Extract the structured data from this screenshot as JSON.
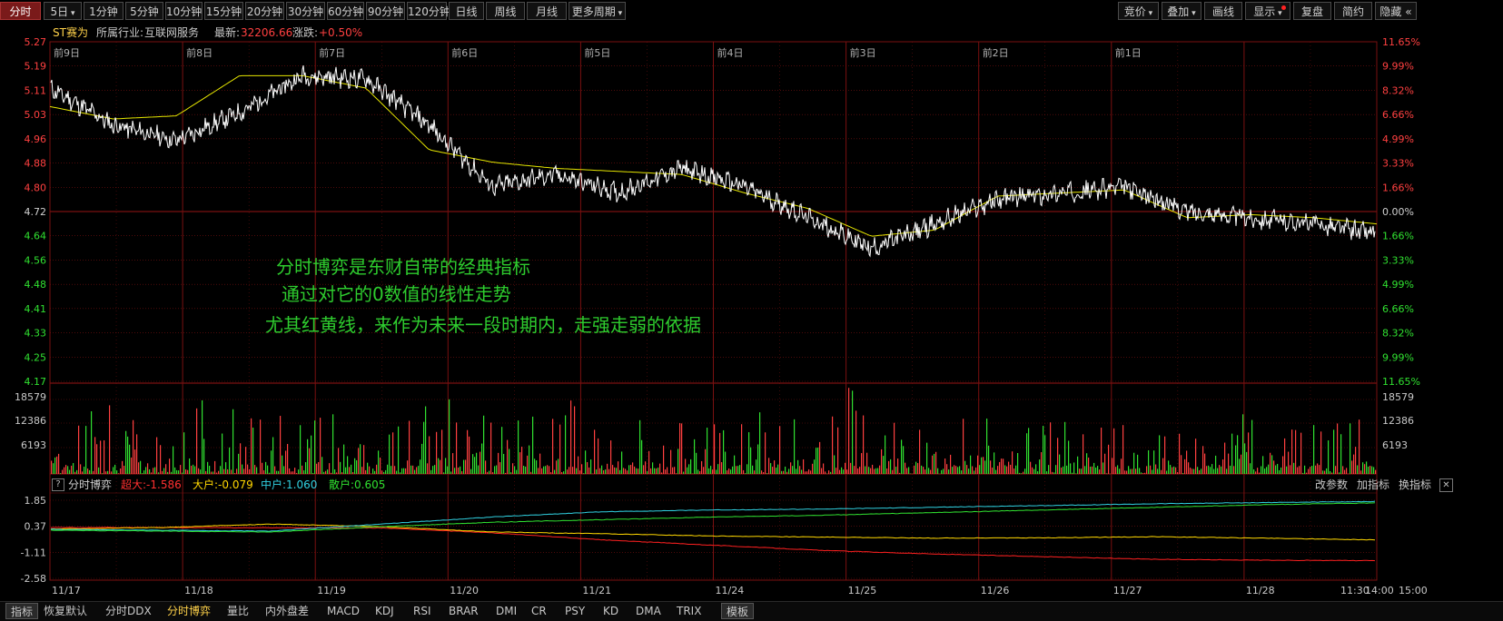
{
  "toolbar": {
    "left": [
      {
        "label": "分时",
        "active": true
      },
      {
        "label": "5日",
        "dropdown": true
      },
      {
        "label": "1分钟"
      },
      {
        "label": "5分钟"
      },
      {
        "label": "10分钟"
      },
      {
        "label": "15分钟"
      },
      {
        "label": "20分钟"
      },
      {
        "label": "30分钟"
      },
      {
        "label": "60分钟"
      },
      {
        "label": "90分钟"
      },
      {
        "label": "120分钟"
      },
      {
        "label": "日线"
      },
      {
        "label": "周线"
      },
      {
        "label": "月线"
      },
      {
        "label": "更多周期",
        "dropdown": true
      }
    ],
    "right": [
      {
        "label": "竞价",
        "dropdown": true
      },
      {
        "label": "叠加",
        "dropdown": true
      },
      {
        "label": "画线"
      },
      {
        "label": "显示",
        "dropdown": true,
        "dot": true
      },
      {
        "label": "复盘"
      },
      {
        "label": "简约"
      },
      {
        "label": "隐藏",
        "arrow": "«"
      }
    ]
  },
  "info": {
    "stock_name": "ST赛为",
    "industry_label": "所属行业:",
    "industry": "互联网服务",
    "latest_label": "最新:",
    "latest": "32206.66",
    "change_label": "涨跌:",
    "change": "+0.50%"
  },
  "day_labels": [
    "前9日",
    "前8日",
    "前7日",
    "前6日",
    "前5日",
    "前4日",
    "前3日",
    "前2日",
    "前1日"
  ],
  "price_axis": {
    "left": [
      "5.27",
      "5.19",
      "5.11",
      "5.03",
      "4.96",
      "4.88",
      "4.80",
      "4.72",
      "4.64",
      "4.56",
      "4.48",
      "4.41",
      "4.33",
      "4.25",
      "4.17"
    ],
    "right": [
      "11.65%",
      "9.99%",
      "8.32%",
      "6.66%",
      "4.99%",
      "3.33%",
      "1.66%",
      "0.00%",
      "1.66%",
      "3.33%",
      "4.99%",
      "6.66%",
      "8.32%",
      "9.99%",
      "11.65%"
    ]
  },
  "volume_axis": {
    "left": [
      "18579",
      "12386",
      "6193"
    ],
    "right": [
      "18579",
      "12386",
      "6193"
    ]
  },
  "indicator": {
    "help": "?",
    "name": "分时博弈",
    "items": [
      {
        "label": "超大:",
        "value": "-1.586",
        "color": "#ff3030"
      },
      {
        "label": "大户:",
        "value": "-0.079",
        "color": "#ffd700"
      },
      {
        "label": "中户:",
        "value": "1.060",
        "color": "#30d0e0"
      },
      {
        "label": "散户:",
        "value": "0.605",
        "color": "#30e030"
      }
    ],
    "actions": [
      "改参数",
      "加指标",
      "换指标"
    ],
    "close": "✕",
    "axis": [
      "1.85",
      "0.37",
      "-1.11",
      "-2.58"
    ]
  },
  "x_axis": [
    "11/17",
    "11/18",
    "11/19",
    "11/20",
    "11/21",
    "11/24",
    "11/25",
    "11/26",
    "11/27",
    "11/28",
    "11:30",
    "14:00",
    "15:00"
  ],
  "annotations": [
    "分时博弈是东财自带的经典指标",
    "通过对它的0数值的线性走势",
    "尤其红黄线，来作为未来一段时期内，走强走弱的依据"
  ],
  "bottom_tabs": [
    {
      "label": "指标",
      "boxed": true
    },
    {
      "label": "恢复默认"
    },
    {
      "label": "分时DDX"
    },
    {
      "label": "分时博弈",
      "active": true
    },
    {
      "label": "量比"
    },
    {
      "label": "内外盘差"
    },
    {
      "label": "MACD"
    },
    {
      "label": "KDJ"
    },
    {
      "label": "RSI"
    },
    {
      "label": "BRAR"
    },
    {
      "label": "DMI"
    },
    {
      "label": "CR"
    },
    {
      "label": "PSY"
    },
    {
      "label": "KD"
    },
    {
      "label": "DMA"
    },
    {
      "label": "TRIX"
    },
    {
      "label": "模板",
      "boxed": true
    }
  ],
  "colors": {
    "price_line": "#ffffff",
    "avg_line": "#e6e600",
    "up": "#ff4040",
    "down": "#30e030",
    "grid": "#7a1010",
    "super": "#ff2020",
    "big": "#ffd700",
    "mid": "#30d0e0",
    "retail": "#30e030",
    "annotation": "#2ecc2e"
  },
  "chart_data": {
    "type": "line",
    "days": [
      "11/17",
      "11/18",
      "11/19",
      "11/20",
      "11/21",
      "11/24",
      "11/25",
      "11/26",
      "11/27",
      "11/28"
    ],
    "ylim": [
      4.17,
      5.27
    ],
    "reference_price": 4.72,
    "series": [
      {
        "values": [
          5.12,
          5.0,
          4.95,
          5.04,
          5.16,
          5.15,
          5.0,
          4.8,
          4.84,
          4.78,
          4.86,
          4.8,
          4.7,
          4.6,
          4.68,
          4.76,
          4.78,
          4.8,
          4.72,
          4.7,
          4.68,
          4.65
        ]
      },
      {
        "values": [
          5.06,
          5.02,
          5.03,
          5.16,
          5.16,
          5.12,
          4.92,
          4.88,
          4.86,
          4.85,
          4.84,
          4.78,
          4.73,
          4.64,
          4.66,
          4.77,
          4.78,
          4.79,
          4.7,
          4.71,
          4.7,
          4.68
        ]
      }
    ],
    "indicator": {
      "ylim": [
        -2.58,
        1.85
      ],
      "series": [
        {
          "name": "超大",
          "values": [
            0.3,
            0.3,
            0.29,
            0.28,
            0.0,
            -0.4,
            -0.7,
            -1.0,
            -1.2,
            -1.35,
            -1.5,
            -1.55,
            -1.58,
            -1.586
          ]
        },
        {
          "name": "大户",
          "values": [
            0.22,
            0.3,
            0.5,
            0.35,
            0.05,
            -0.05,
            -0.18,
            -0.24,
            -0.3,
            -0.28,
            -0.22,
            -0.3,
            -0.4,
            -0.079
          ]
        },
        {
          "name": "中户",
          "values": [
            0.2,
            0.15,
            0.1,
            0.5,
            0.9,
            1.2,
            1.3,
            1.35,
            1.45,
            1.55,
            1.65,
            1.72,
            1.78,
            1.06
          ]
        },
        {
          "name": "散户",
          "values": [
            0.15,
            0.1,
            0.05,
            0.35,
            0.6,
            0.75,
            0.9,
            1.0,
            1.15,
            1.3,
            1.45,
            1.6,
            1.7,
            0.605
          ]
        }
      ]
    }
  }
}
